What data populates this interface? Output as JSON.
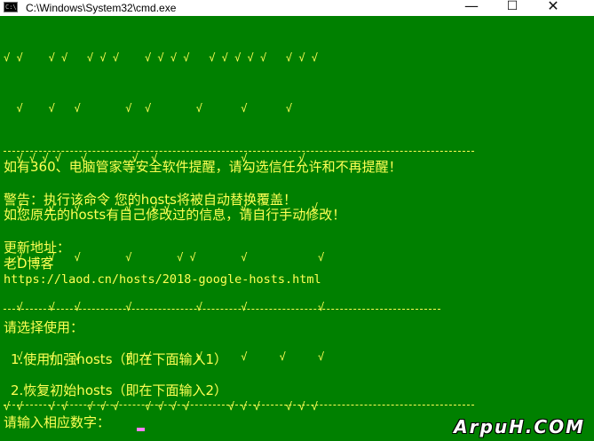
{
  "window": {
    "title": "C:\\Windows\\System32\\cmd.exe",
    "icon": "cmd-icon",
    "icon_text": "C:\\",
    "minimize_glyph": "—",
    "maximize_glyph": "☐",
    "close_glyph": "✕"
  },
  "banner": {
    "art_lines": [
      "√ √    √ √   √ √ √    √ √ √ √   √ √ √ √ √   √ √ √",
      "  √    √   √       √  √       √      √      √",
      "  √ √ √ √   √       √  √             √        √",
      "  √    √   √       √   √ √           √          √",
      "  √    √   √       √       √ √       √           √",
      "  √    √   √       √          √      √           √",
      "  √    √   √       √  √       √      √     √     √",
      "√ √    √ √   √ √ √    √ √ √ √      √ √ √    √ √ √"
    ]
  },
  "messages": {
    "warning_security": "如有360、电脑管家等安全软件提醒，请勾选信任允许和不再提醒！",
    "warning_overwrite": "警告：执行该命令 您的hosts将被自动替换覆盖！",
    "warning_modified": "如您原先的hosts有自己修改过的信息，请自行手动修改！",
    "update_label": "更新地址：",
    "blog_name": "老D博客",
    "update_url": "https://laod.cn/hosts/2018-google-hosts.html"
  },
  "menu": {
    "prompt": "请选择使用：",
    "options": [
      "1.使用加强hosts（即在下面输入1）",
      "2.恢复初始hosts（即在下面输入2）"
    ],
    "input_prompt": "请输入相应数字："
  },
  "watermark": "ArpuH.COM",
  "colors": {
    "background": "#008000",
    "text": "#ffff55",
    "cursor": "#ff80ff"
  }
}
